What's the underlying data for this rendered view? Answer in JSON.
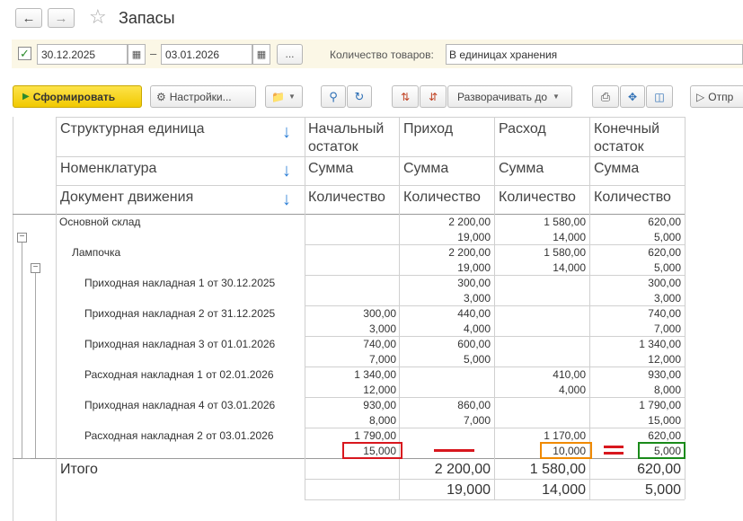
{
  "window": {
    "title": "Запасы"
  },
  "params": {
    "date_from": "30.12.2025",
    "date_to": "03.01.2026",
    "dash": "–",
    "dots": "...",
    "qty_label": "Количество товаров:",
    "qty_value": "В единицах хранения"
  },
  "toolbar": {
    "generate": "Сформировать",
    "settings": "Настройки...",
    "expand": "Разворачивать до",
    "prop": "Отпр"
  },
  "report": {
    "headers": {
      "dimensions": [
        "Структурная единица",
        "Номенклатура",
        "Документ движения"
      ],
      "col1": "Начальный остаток",
      "col2": "Приход",
      "col3": "Расход",
      "col4": "Конечный остаток",
      "sum": "Сумма",
      "qty": "Количество"
    },
    "rows": [
      {
        "label": "Основной склад",
        "indent": 0,
        "sum": [
          "",
          "2 200,00",
          "1 580,00",
          "620,00"
        ],
        "qty": [
          "",
          "19,000",
          "14,000",
          "5,000"
        ]
      },
      {
        "label": "Лампочка",
        "indent": 1,
        "sum": [
          "",
          "2 200,00",
          "1 580,00",
          "620,00"
        ],
        "qty": [
          "",
          "19,000",
          "14,000",
          "5,000"
        ]
      },
      {
        "label": "Приходная накладная 1 от 30.12.2025",
        "indent": 2,
        "sum": [
          "",
          "300,00",
          "",
          "300,00"
        ],
        "qty": [
          "",
          "3,000",
          "",
          "3,000"
        ]
      },
      {
        "label": "Приходная накладная 2 от 31.12.2025",
        "indent": 2,
        "sum": [
          "300,00",
          "440,00",
          "",
          "740,00"
        ],
        "qty": [
          "3,000",
          "4,000",
          "",
          "7,000"
        ]
      },
      {
        "label": "Приходная накладная 3 от 01.01.2026",
        "indent": 2,
        "sum": [
          "740,00",
          "600,00",
          "",
          "1 340,00"
        ],
        "qty": [
          "7,000",
          "5,000",
          "",
          "12,000"
        ]
      },
      {
        "label": "Расходная накладная 1 от 02.01.2026",
        "indent": 2,
        "sum": [
          "1 340,00",
          "",
          "410,00",
          "930,00"
        ],
        "qty": [
          "12,000",
          "",
          "4,000",
          "8,000"
        ]
      },
      {
        "label": "Приходная накладная 4 от 03.01.2026",
        "indent": 2,
        "sum": [
          "930,00",
          "860,00",
          "",
          "1 790,00"
        ],
        "qty": [
          "8,000",
          "7,000",
          "",
          "15,000"
        ]
      },
      {
        "label": "Расходная накладная 2 от 03.01.2026",
        "indent": 2,
        "sum": [
          "1 790,00",
          "",
          "1 170,00",
          "620,00"
        ],
        "qty": [
          "15,000",
          "",
          "10,000",
          "5,000"
        ]
      }
    ],
    "total": {
      "label": "Итого",
      "sum": [
        "",
        "2 200,00",
        "1 580,00",
        "620,00"
      ],
      "qty": [
        "",
        "19,000",
        "14,000",
        "5,000"
      ]
    }
  },
  "annotations": {
    "colors": {
      "red": "#d8171e",
      "orange": "#f08a00",
      "green": "#1a8a1a"
    }
  }
}
